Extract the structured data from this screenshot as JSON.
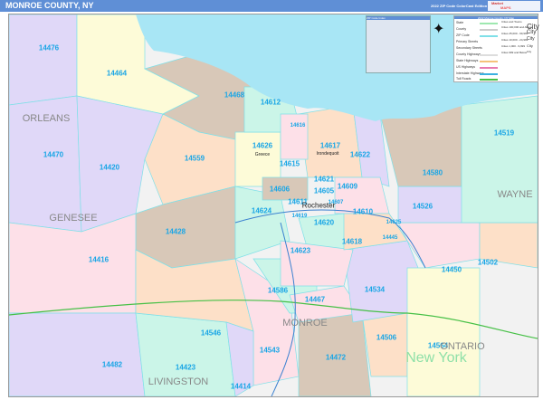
{
  "header": {
    "title": "MONROE COUNTY, NY",
    "edition": "2022 ZIP Code ColorCast Edition",
    "logo_text": [
      "Market",
      "MAPS"
    ]
  },
  "ziptable": {
    "title": "ZIP Code Index"
  },
  "legend": {
    "title": "2022 Monroe County, NY Map",
    "items": [
      "State",
      "County",
      "ZIP Code",
      "Primary Streets",
      "Secondary Streets",
      "County Highways",
      "State Highways",
      "US Highways",
      "Interstate Highways",
      "Toll Roads"
    ],
    "colors": [
      "#9ee8b0",
      "#cccccc",
      "#7fe0e8",
      "#eeeeee",
      "#f4f4f4",
      "#dddddd",
      "#f5c27a",
      "#e87ab0",
      "#3ab0e0",
      "#46c046"
    ],
    "cities_title": "Cities and Towns",
    "city_sizes": [
      {
        "label": "Cities 100,000 and Above",
        "sample": "City"
      },
      {
        "label": "Cities 25,000 - 99,999",
        "sample": "City"
      },
      {
        "label": "Cities 10,000 - 24,999",
        "sample": "City"
      },
      {
        "label": "Cities 1,000 - 9,999",
        "sample": "City"
      },
      {
        "label": "Cities 999 and Below",
        "sample": "City"
      }
    ]
  },
  "map": {
    "zips": [
      "14476",
      "14464",
      "14468",
      "14612",
      "14616",
      "14626",
      "14617",
      "14622",
      "14615",
      "14621",
      "14606",
      "14609",
      "14605",
      "14611",
      "14624",
      "14619",
      "14620",
      "14610",
      "14618",
      "14623",
      "14428",
      "14416",
      "14420",
      "14470",
      "14559",
      "14519",
      "14580",
      "14526",
      "14502",
      "14450",
      "14534",
      "14586",
      "14467",
      "14546",
      "14506",
      "14564",
      "14543",
      "14472",
      "14482",
      "14423",
      "14414",
      "14445",
      "14625",
      "14607"
    ],
    "counties": [
      "ORLEANS",
      "GENESEE",
      "WAYNE",
      "MONROE",
      "LIVINGSTON",
      "ONTARIO"
    ],
    "state": "New York",
    "cities": [
      "Rochester",
      "Greece",
      "Irondequoit"
    ]
  }
}
